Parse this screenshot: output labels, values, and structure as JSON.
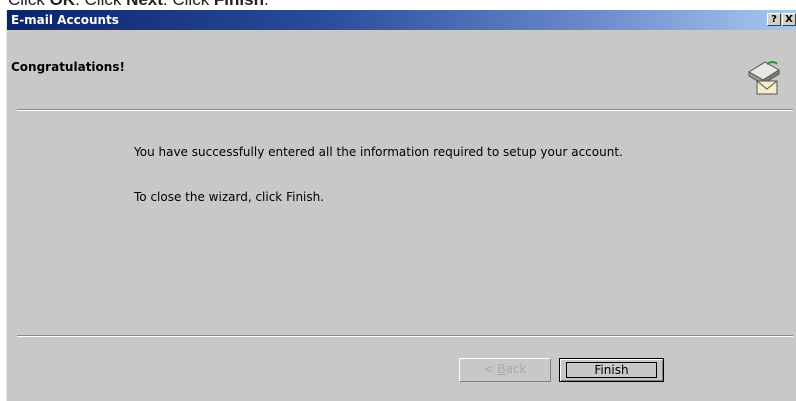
{
  "caption": {
    "text_parts": [
      "Click ",
      "OK",
      ". Click ",
      "Next",
      ". Click ",
      "Finish",
      "."
    ]
  },
  "dialog": {
    "title": "E-mail Accounts",
    "help_button": "?",
    "close_button": "X",
    "heading": "Congratulations!",
    "icon": "envelope-card-icon",
    "message_1": "You have successfully entered all the information required to setup your account.",
    "message_2": "To close the wizard, click Finish.",
    "back_button": {
      "prefix": "< ",
      "accelerator": "B",
      "rest": "ack",
      "enabled": false
    },
    "finish_button": "Finish"
  },
  "colors": {
    "title_gradient_start": "#0a246a",
    "title_gradient_end": "#a6caf0",
    "dialog_face": "#c8c8c8",
    "disabled_text": "#a8a8a8"
  }
}
